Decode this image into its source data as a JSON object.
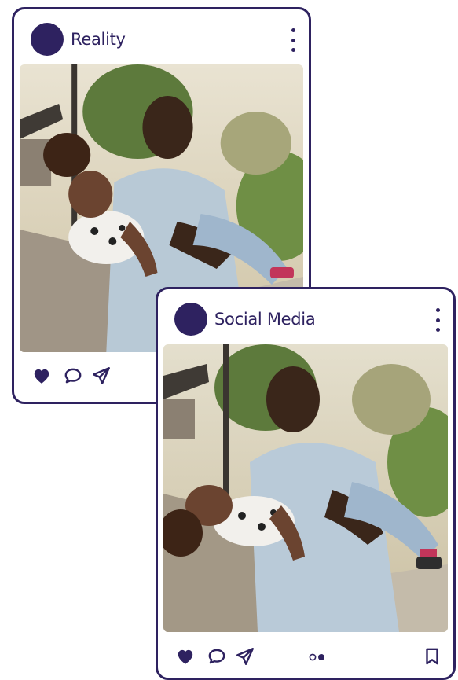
{
  "posts": [
    {
      "username": "Reality",
      "photo_subject": "Man carrying frowning child",
      "actions": [
        "heart-icon",
        "comment-icon",
        "share-icon"
      ]
    },
    {
      "username": "Social Media",
      "photo_subject": "Man carrying laughing child",
      "actions": [
        "heart-icon",
        "comment-icon",
        "share-icon",
        "carousel-dots-icon",
        "bookmark-icon"
      ]
    }
  ],
  "colors": {
    "accent": "#2e2260",
    "card_background": "#ffffff"
  }
}
